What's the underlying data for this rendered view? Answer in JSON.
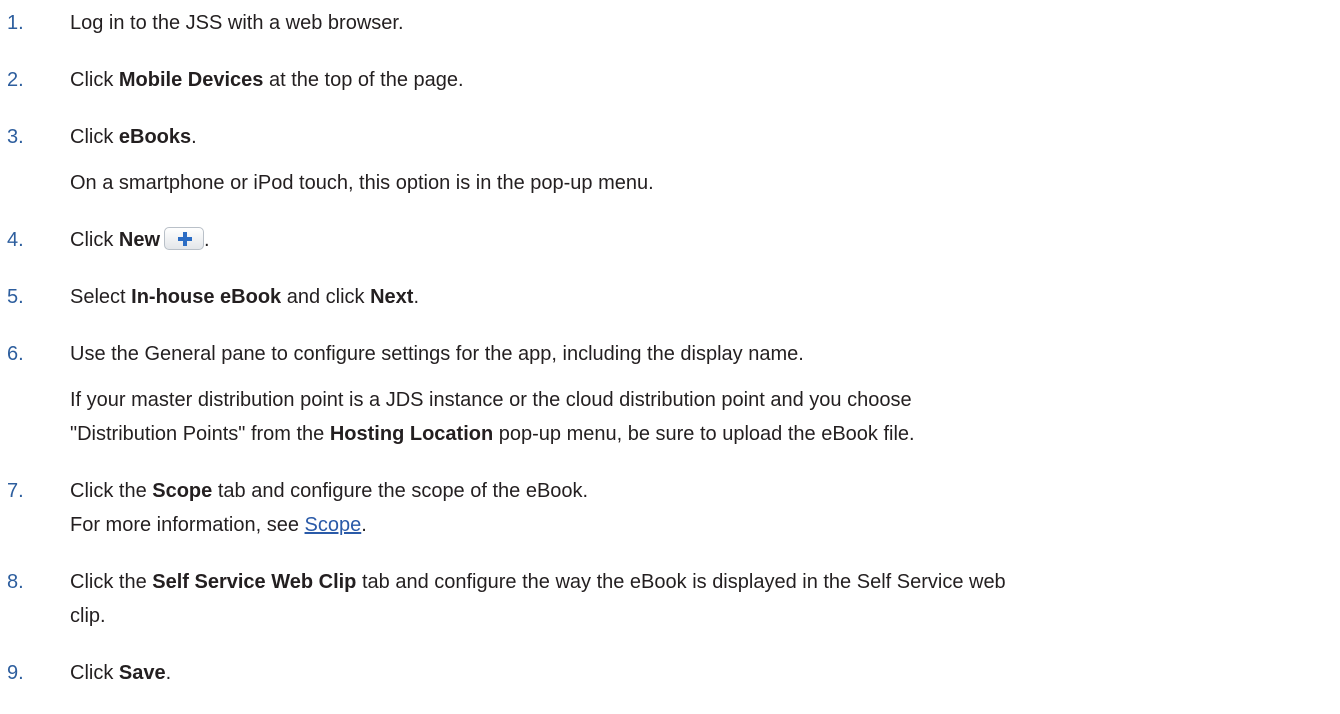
{
  "steps": [
    {
      "num": "1.",
      "text": "Log in to the JSS with a web browser."
    },
    {
      "num": "2.",
      "pre": "Click ",
      "bold": "Mobile Devices",
      "post": " at the top of the page."
    },
    {
      "num": "3.",
      "pre": "Click ",
      "bold": "eBooks",
      "post": ".",
      "note": "On a smartphone or iPod touch, this option is in the pop-up menu."
    },
    {
      "num": "4.",
      "pre": "Click ",
      "bold": "New",
      "post": ".",
      "button_icon": "plus-icon"
    },
    {
      "num": "5.",
      "pre": "Select ",
      "bold1": "In-house eBook",
      "mid": " and click ",
      "bold2": "Next",
      "post": "."
    },
    {
      "num": "6.",
      "text": "Use the General pane to configure settings for the app, including the display name.",
      "note_line1": "If your master distribution point is a JDS instance or the cloud distribution point and you choose",
      "note_pre": "\"Distribution Points\" from the ",
      "note_bold": "Hosting Location",
      "note_post": " pop-up menu, be sure to upload the eBook file."
    },
    {
      "num": "7.",
      "pre": "Click the ",
      "bold": "Scope",
      "post": " tab and configure the scope of the eBook.",
      "note_pre": "For more information, see ",
      "note_link": "Scope",
      "note_post": "."
    },
    {
      "num": "8.",
      "pre": "Click the ",
      "bold": "Self Service Web Clip",
      "post": " tab and configure the way the eBook is displayed in the Self Service web",
      "line2": "clip."
    },
    {
      "num": "9.",
      "pre": "Click ",
      "bold": "Save",
      "post": "."
    }
  ],
  "colors": {
    "step_number": "#2d5e9e",
    "link": "#2a5aa8",
    "plus_icon": "#2b6cc4"
  }
}
